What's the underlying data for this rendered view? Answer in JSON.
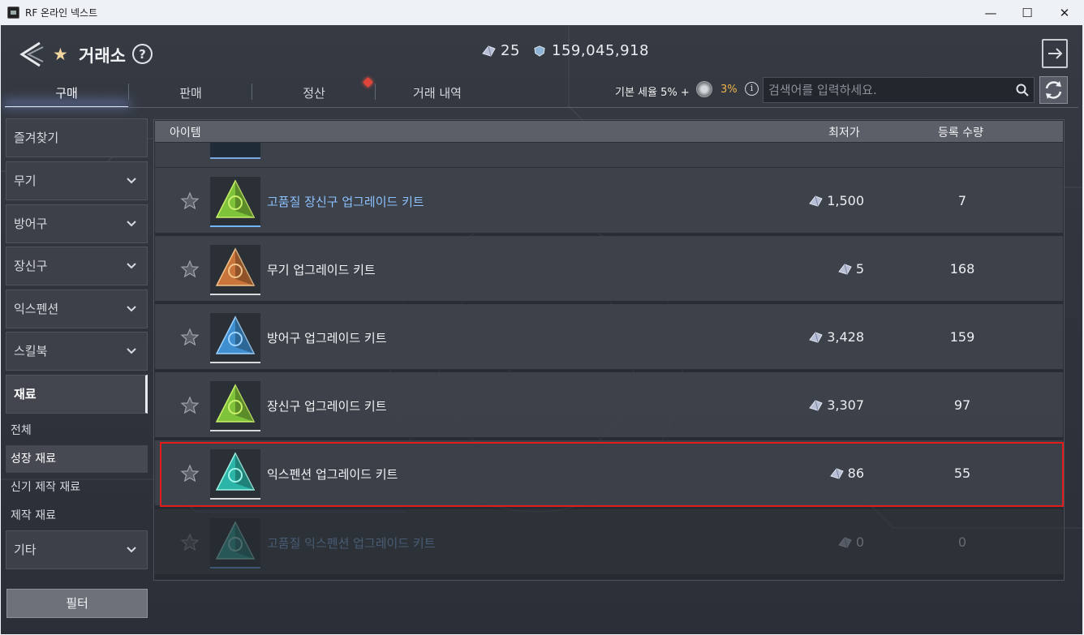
{
  "window": {
    "title": "RF 온라인 넥스트",
    "minimize": "—",
    "maximize": "☐",
    "close": "✕"
  },
  "header": {
    "title": "거래소",
    "help": "?",
    "currency_gem": "25",
    "currency_silver": "159,045,918"
  },
  "tabs": [
    {
      "label": "구매",
      "active": true
    },
    {
      "label": "판매",
      "active": false
    },
    {
      "label": "정산",
      "active": false
    },
    {
      "label": "거래 내역",
      "active": false
    }
  ],
  "tax": {
    "base_label": "기본 세율 5% +",
    "extra": "3%",
    "info": "i"
  },
  "search": {
    "placeholder": "검색어를 입력하세요."
  },
  "sidebar": {
    "items": [
      {
        "label": "즐겨찾기",
        "has_chevron": false
      },
      {
        "label": "무기",
        "has_chevron": true
      },
      {
        "label": "방어구",
        "has_chevron": true
      },
      {
        "label": "장신구",
        "has_chevron": true
      },
      {
        "label": "익스펜션",
        "has_chevron": true
      },
      {
        "label": "스킬북",
        "has_chevron": true
      },
      {
        "label": "재료",
        "has_chevron": false,
        "active": true
      }
    ],
    "subitems": [
      {
        "label": "전체"
      },
      {
        "label": "성장 재료",
        "active": true
      },
      {
        "label": "신기 제작 재료"
      },
      {
        "label": "제작 재료"
      }
    ],
    "other": {
      "label": "기타"
    },
    "filter_label": "필터"
  },
  "table": {
    "headers": {
      "item": "아이템",
      "lowest_price": "최저가",
      "quantity": "등록 수량"
    },
    "rows": [
      {
        "name": "고품질 장신구 업그레이드 키트",
        "price": "1,500",
        "quantity": "7",
        "name_color": "blue",
        "icon": "green-pyramid",
        "dim": false
      },
      {
        "name": "무기 업그레이드 키트",
        "price": "5",
        "quantity": "168",
        "name_color": "white",
        "icon": "orange-pyramid",
        "dim": false
      },
      {
        "name": "방어구 업그레이드 키트",
        "price": "3,428",
        "quantity": "159",
        "name_color": "white",
        "icon": "blue-pyramid",
        "dim": false
      },
      {
        "name": "장신구 업그레이드 키트",
        "price": "3,307",
        "quantity": "97",
        "name_color": "white",
        "icon": "green-pyramid",
        "dim": false
      },
      {
        "name": "익스펜션 업그레이드 키트",
        "price": "86",
        "quantity": "55",
        "name_color": "white",
        "icon": "teal-pyramid",
        "dim": false,
        "highlighted": true
      },
      {
        "name": "고품질 익스펜션 업그레이드 키트",
        "price": "0",
        "quantity": "0",
        "name_color": "blue",
        "icon": "teal-pyramid",
        "dim": true
      }
    ]
  },
  "colors": {
    "accent_orange": "#f0b64b",
    "highlight_red": "#e21b1b",
    "blue_name": "#8cc1ff",
    "green_icon": "#7ec33a",
    "orange_icon": "#c8743a",
    "blue_icon": "#3f8fd0",
    "teal_icon": "#2bb5a8"
  }
}
